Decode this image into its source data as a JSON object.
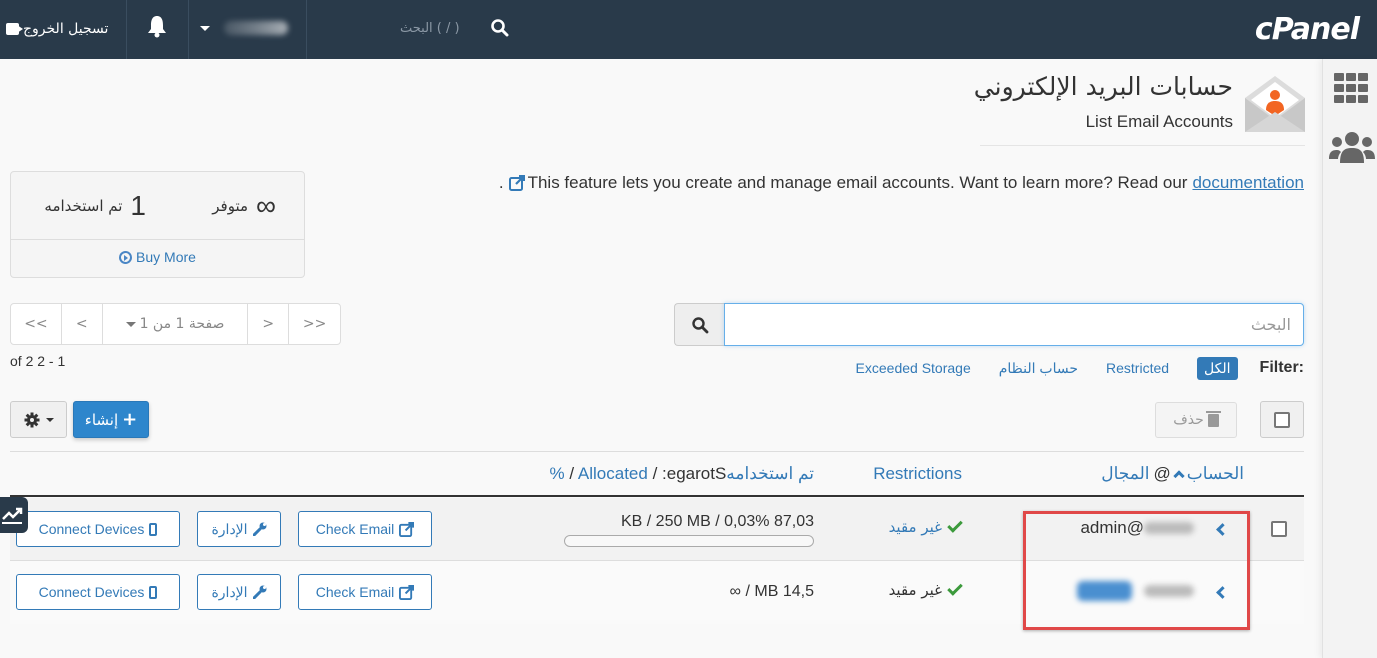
{
  "topbar": {
    "logo": "cPanel",
    "search_placeholder": "البحث ( / )",
    "logout_label": "تسجيل الخروج",
    "username": "[blurred]"
  },
  "sidebar": {
    "items": [
      {
        "icon": "grid-icon",
        "label": "Home"
      },
      {
        "icon": "users-icon",
        "label": "User Manager"
      }
    ]
  },
  "header": {
    "title": "حسابات البريد الإلكتروني",
    "subtitle": "List Email Accounts"
  },
  "description": {
    "text": "This feature lets you create and manage email accounts. Want to learn more? Read our",
    "link": "documentation",
    "suffix": "."
  },
  "stats": {
    "available_value": "∞",
    "available_label": "متوفر",
    "used_value": "1",
    "used_label": "تم استخدامه",
    "buy_more": "Buy More"
  },
  "pagination": {
    "first": "<<",
    "prev": "<",
    "page_select": "صفحة 1 من 1",
    "next": ">",
    "last": ">>",
    "range": "of 2 2 - 1"
  },
  "search": {
    "placeholder": "البحث",
    "value": ""
  },
  "filter": {
    "label": "Filter:",
    "options": [
      {
        "label": "الكل",
        "active": true
      },
      {
        "label": "Restricted",
        "active": false
      },
      {
        "label": "حساب النظام",
        "active": false
      },
      {
        "label": "Exceeded Storage",
        "active": false
      }
    ]
  },
  "actions": {
    "create_label": "إنشاء",
    "delete_label": "حذف"
  },
  "table": {
    "headers": {
      "account": "الحساب",
      "at": "@",
      "domain": "المجال",
      "restrictions": "Restrictions",
      "storage_prefix": "Storage:",
      "storage_used": "تم استخدامه",
      "storage_allocated": "Allocated",
      "storage_percent": "%",
      "sep": " / "
    },
    "rows": [
      {
        "account": "admin@",
        "account_domain": "[blurred]",
        "restriction": "غير مقيد",
        "storage": "87,03 KB / 250 MB / 0,03%",
        "storage_display": "KB / 250 MB / 0,03% 87,03",
        "usage_percent": 0.03,
        "buttons": {
          "connect": "Connect Devices",
          "manage": "الإدارة",
          "check": "Check Email"
        }
      },
      {
        "account": "[blurred]",
        "account_domain": "[blurred]",
        "restriction": "غير مقيد",
        "storage": "14,5 MB / ∞",
        "storage_display": "∞ / MB 14,5",
        "usage_percent": null,
        "buttons": {
          "connect": "Connect Devices",
          "manage": "الإدارة",
          "check": "Check Email"
        }
      }
    ]
  },
  "colors": {
    "topbar": "#293a4a",
    "accent": "#337ab7",
    "primary_button": "#2e86cc",
    "success": "#3c9a3c",
    "highlight": "#e04848",
    "envelope_person": "#f26522"
  }
}
